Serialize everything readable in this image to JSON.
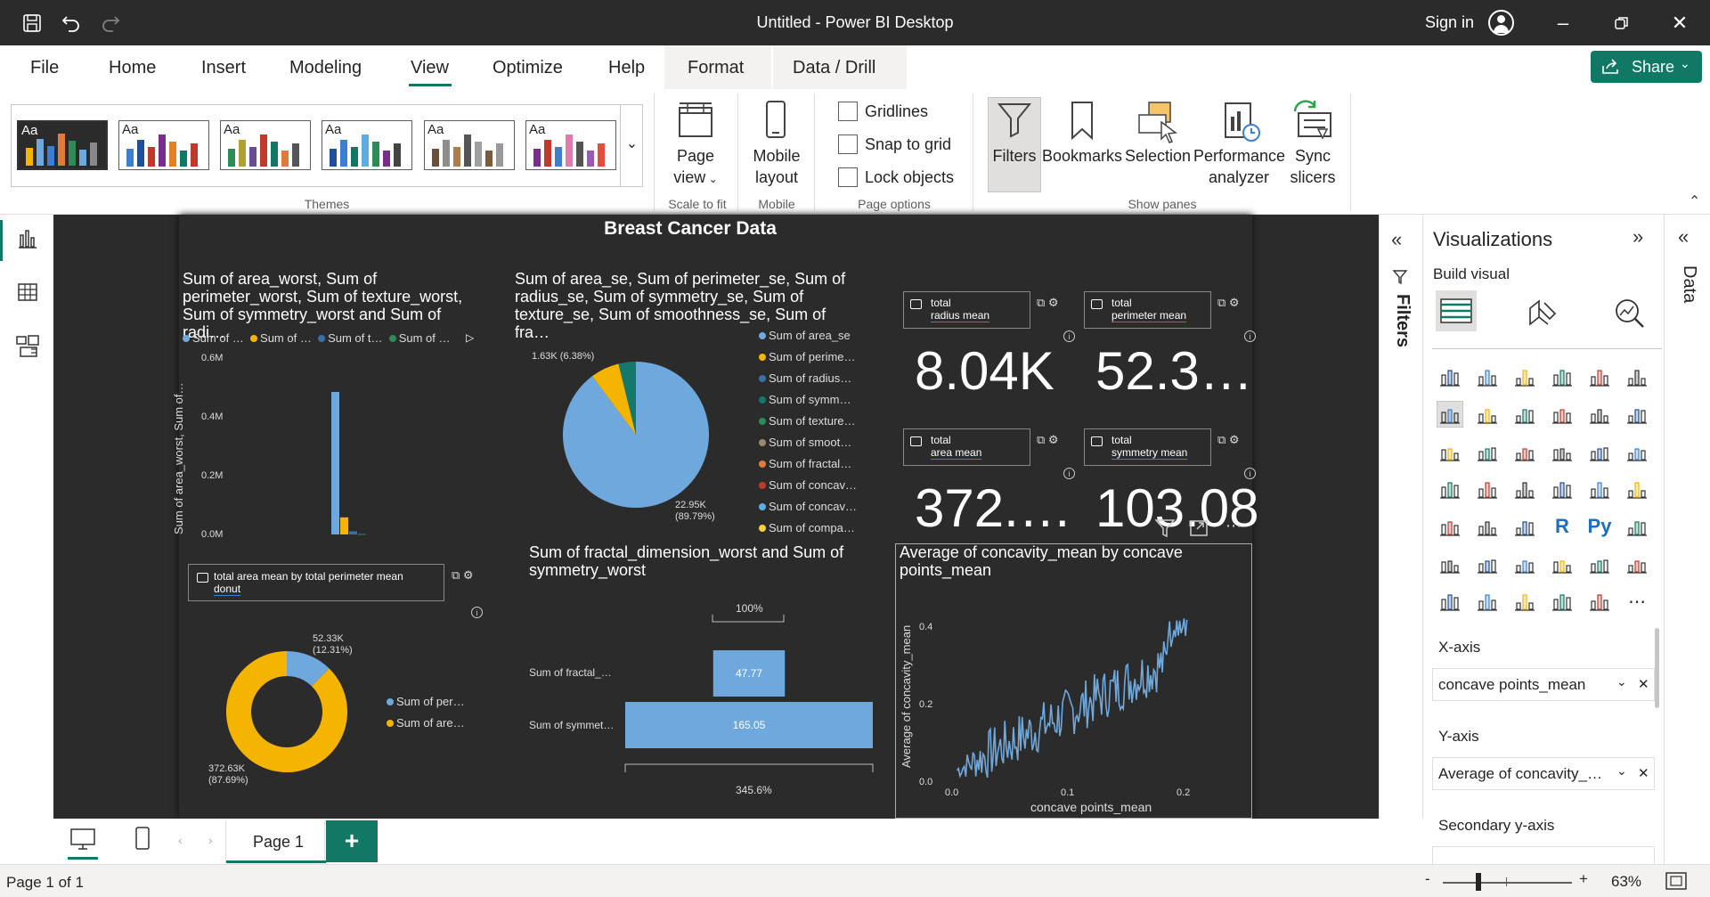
{
  "window": {
    "title": "Untitled - Power BI Desktop",
    "sign_in": "Sign in"
  },
  "menu": {
    "items": [
      "File",
      "Home",
      "Insert",
      "Modeling",
      "View",
      "Optimize",
      "Help"
    ],
    "context_tabs": [
      "Format",
      "Data / Drill"
    ],
    "share": "Share"
  },
  "ribbon": {
    "themes_group": "Themes",
    "page_view": [
      "Page",
      "view"
    ],
    "scale_to_fit": "Scale to fit",
    "mobile_layout": [
      "Mobile",
      "layout"
    ],
    "mobile_group": "Mobile",
    "checkboxes": [
      "Gridlines",
      "Snap to grid",
      "Lock objects"
    ],
    "page_options_group": "Page options",
    "panes": [
      "Filters",
      "Bookmarks",
      "Selection"
    ],
    "performance": [
      "Performance",
      "analyzer"
    ],
    "sync": [
      "Sync",
      "slicers"
    ],
    "show_panes_group": "Show panes",
    "theme_label": "Aa"
  },
  "report": {
    "title": "Breast Cancer Data",
    "v1": {
      "title": "Sum of area_worst, Sum of perimeter_worst, Sum of texture_worst, Sum of symmetry_worst and Sum of radi…",
      "legend": [
        "Sum of …",
        "Sum of …",
        "Sum of t…",
        "Sum of …"
      ],
      "ylabel": "Sum of area_worst, Sum of…",
      "ticks": [
        "0.6M",
        "0.4M",
        "0.2M",
        "0.0M"
      ]
    },
    "v2": {
      "title": "Sum of area_se, Sum of perimeter_se, Sum of radius_se, Sum of symmetry_se, Sum of texture_se, Sum of smoothness_se, Sum of fra…",
      "label_small": "1.63K (6.38%)",
      "label_big_1": "22.95K",
      "label_big_2": "(89.79%)",
      "legend": [
        "Sum of area_se",
        "Sum of perime…",
        "Sum of radius…",
        "Sum of symm…",
        "Sum of texture…",
        "Sum of smoot…",
        "Sum of fractal…",
        "Sum of concav…",
        "Sum of concav…",
        "Sum of compa…"
      ]
    },
    "cards": [
      {
        "l1": "total",
        "l2": "radius mean",
        "value": "8.04K"
      },
      {
        "l1": "total",
        "l2": "perimeter mean",
        "value": "52.3…"
      },
      {
        "l1": "total",
        "l2": "area mean",
        "value": "372.…"
      },
      {
        "l1": "total",
        "l2": "symmetry mean",
        "value": "103.08"
      }
    ],
    "v3": {
      "header": "total area mean by total perimeter mean",
      "header2": "donut",
      "label_a_1": "52.33K",
      "label_a_2": "(12.31%)",
      "label_b_1": "372.63K",
      "label_b_2": "(87.69%)",
      "legend": [
        "Sum of per…",
        "Sum of are…"
      ]
    },
    "v4": {
      "title": "Sum of fractal_dimension_worst and Sum of symmetry_worst",
      "top": "100%",
      "bottom": "345.6%",
      "rows": [
        "Sum of fractal_…",
        "Sum of symmet…"
      ],
      "values": [
        "47.77",
        "165.05"
      ]
    },
    "v5": {
      "title": "Average of concavity_mean by concave points_mean",
      "ylabel": "Average of concavity_mean",
      "xlabel": "concave points_mean",
      "yticks": [
        "0.4",
        "0.2",
        "0.0"
      ],
      "xticks": [
        "0.0",
        "0.1",
        "0.2"
      ]
    }
  },
  "chart_data": [
    {
      "type": "bar",
      "title": "Sum of area_worst, Sum of perimeter_worst, Sum of texture_worst, Sum of symmetry_worst and Sum of radi…",
      "ylabel": "Sum of area_worst, Sum of…",
      "ylim": [
        0,
        600000
      ],
      "series": [
        {
          "name": "Sum of …",
          "values": [
            500000
          ]
        },
        {
          "name": "Sum of …",
          "values": [
            60000
          ]
        },
        {
          "name": "Sum of t…",
          "values": [
            11000
          ]
        },
        {
          "name": "Sum of …",
          "values": [
            2000
          ]
        }
      ]
    },
    {
      "type": "pie",
      "slices": [
        {
          "label": "Sum of area_se",
          "value": 22950
        },
        {
          "label": "Sum of perime…",
          "value": 1630
        },
        {
          "label": "Sum of symm…",
          "value": 980
        }
      ]
    },
    {
      "type": "pie",
      "donut": true,
      "slices": [
        {
          "label": "Sum of are…",
          "value": 372630
        },
        {
          "label": "Sum of per…",
          "value": 52330
        }
      ]
    },
    {
      "type": "bar",
      "title": "Sum of fractal_dimension_worst and Sum of symmetry_worst",
      "categories": [
        "Sum of fractal_…",
        "Sum of symmet…"
      ],
      "values": [
        47.77,
        165.05
      ]
    },
    {
      "type": "line",
      "title": "Average of concavity_mean by concave points_mean",
      "xlabel": "concave points_mean",
      "ylabel": "Average of concavity_mean",
      "xlim": [
        0,
        0.2
      ],
      "ylim": [
        0,
        0.43
      ]
    }
  ],
  "panes": {
    "filters": "Filters",
    "visualizations": "Visualizations",
    "build_visual": "Build visual",
    "data": "Data",
    "xaxis": "X-axis",
    "xaxis_value": "concave points_mean",
    "yaxis": "Y-axis",
    "yaxis_value": "Average of concavity_…",
    "secondary": "Secondary y-axis"
  },
  "pages": {
    "tab": "Page 1",
    "add": "+"
  },
  "status": {
    "page": "Page 1 of 1",
    "zoom": "63%"
  },
  "colors": {
    "accent": "#117865",
    "blue": "#6fa8dc",
    "gold": "#f4b400",
    "teal": "#14786b",
    "canvas": "#2b2b2b"
  }
}
